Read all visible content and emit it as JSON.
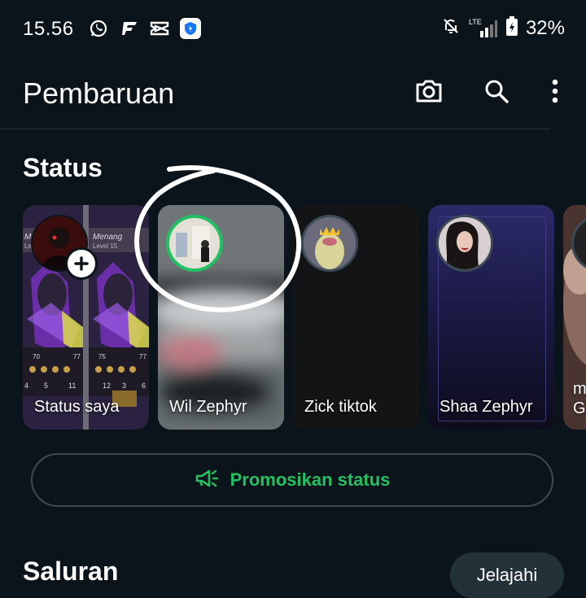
{
  "status_bar": {
    "time": "15.56",
    "battery": "32%",
    "network": "LTE"
  },
  "app_bar": {
    "title": "Pembaruan"
  },
  "status_section": {
    "title": "Status",
    "cards": [
      {
        "name": "Status saya"
      },
      {
        "name": "Wil Zephyr"
      },
      {
        "name": "Zick tiktok"
      },
      {
        "name": "Shaa Zephyr"
      },
      {
        "name": "m G"
      }
    ],
    "my_status_thumbnail_texts": [
      "Menang",
      "Level 15",
      "Menang",
      "Level 15",
      "70",
      "77",
      "75",
      "77",
      "4",
      "5",
      "11",
      "12",
      "3",
      "6"
    ]
  },
  "promo": {
    "label": "Promosikan status"
  },
  "channels_section": {
    "title": "Saluran",
    "explore_label": "Jelajahi"
  },
  "colors": {
    "background": "#0b141a",
    "accent_green": "#21c063",
    "text": "#e9edef"
  },
  "icons": [
    "whatsapp-icon",
    "flipboard-icon",
    "capcut-icon",
    "shield-app-icon",
    "bell-off-icon",
    "signal-icon",
    "battery-icon",
    "camera-icon",
    "search-icon",
    "more-vertical-icon",
    "megaphone-icon",
    "plus-icon"
  ]
}
